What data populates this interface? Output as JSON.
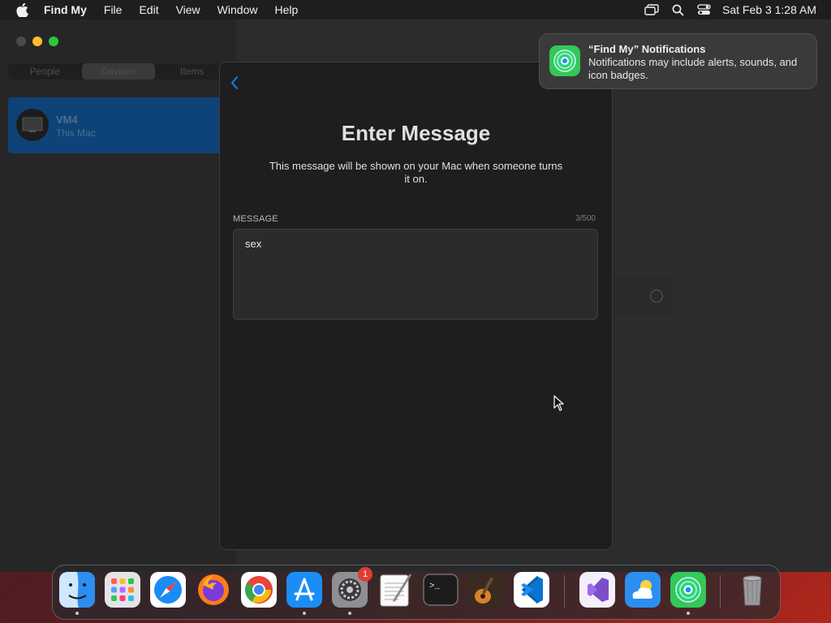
{
  "menubar": {
    "app_name": "Find My",
    "menus": [
      "File",
      "Edit",
      "View",
      "Window",
      "Help"
    ],
    "clock": "Sat Feb 3  1:28 AM"
  },
  "sidebar": {
    "tabs": [
      "People",
      "Devices",
      "Items"
    ],
    "active_tab": "Devices",
    "device": {
      "name": "VM4",
      "subtitle": "This Mac"
    }
  },
  "sheet": {
    "title": "Enter Message",
    "description": "This message will be shown on your Mac when someone turns it on.",
    "message_label": "MESSAGE",
    "message_count": "3/500",
    "message_value": "sex"
  },
  "notification": {
    "title": "“Find My” Notifications",
    "body": "Notifications may include alerts, sounds, and icon badges."
  },
  "dock": {
    "apps": [
      {
        "name": "Finder",
        "running": true
      },
      {
        "name": "Launchpad",
        "running": false
      },
      {
        "name": "Safari",
        "running": false
      },
      {
        "name": "Firefox",
        "running": false
      },
      {
        "name": "Chrome",
        "running": false
      },
      {
        "name": "App Store",
        "running": true
      },
      {
        "name": "System Settings",
        "running": true,
        "badge": "1"
      },
      {
        "name": "TextEdit",
        "running": false
      },
      {
        "name": "Terminal",
        "running": false
      },
      {
        "name": "GarageBand",
        "running": false
      },
      {
        "name": "Visual Studio Code",
        "running": false
      },
      {
        "name": "Visual Studio",
        "running": false
      },
      {
        "name": "Weather",
        "running": false
      },
      {
        "name": "Find My",
        "running": true
      },
      {
        "name": "Trash",
        "running": false
      }
    ]
  },
  "colors": {
    "accent": "#0a84ff",
    "selection": "#0d4378",
    "findmy_green": "#34c759",
    "badge_red": "#e23c31"
  }
}
